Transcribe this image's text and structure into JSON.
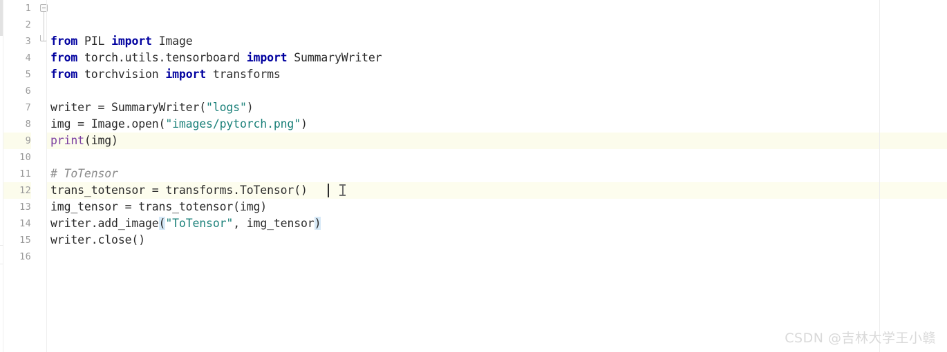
{
  "app": {
    "kind": "code-editor",
    "language": "Python",
    "theme": "light"
  },
  "colors": {
    "background": "#ffffff",
    "keyword": "#00009f",
    "string": "#1a8079",
    "builtin": "#7b3ea0",
    "comment": "#8c8c8c",
    "plain": "#2b2b2b",
    "line_number": "#9a9a9a",
    "current_line_bg": "#fdfdee",
    "bracket_match_bg": "#d6e9f7",
    "gutter_separator": "#eeeeee",
    "margin_guide": "#ededed",
    "watermark": "#d9d9d9"
  },
  "gutter": {
    "line_numbers": [
      "1",
      "2",
      "3",
      "4",
      "5",
      "6",
      "7",
      "8",
      "9",
      "10",
      "11",
      "12",
      "13",
      "14",
      "15",
      "16"
    ],
    "fold_markers": [
      {
        "line": 1,
        "type": "fold-collapse-box"
      },
      {
        "line": 3,
        "type": "fold-region-end"
      }
    ]
  },
  "editor": {
    "current_line": 12,
    "caret": {
      "line": 12,
      "column": 38
    },
    "bracket_match_lines": [
      12
    ],
    "margin_guide_column": 120,
    "lines": [
      {
        "n": 1,
        "text": "from PIL import Image"
      },
      {
        "n": 2,
        "text": "from torch.utils.tensorboard import SummaryWriter"
      },
      {
        "n": 3,
        "text": "from torchvision import transforms"
      },
      {
        "n": 4,
        "text": ""
      },
      {
        "n": 5,
        "text": "writer = SummaryWriter(\"logs\")"
      },
      {
        "n": 6,
        "text": "img = Image.open(\"images/pytorch.png\")"
      },
      {
        "n": 7,
        "text": "print(img)"
      },
      {
        "n": 8,
        "text": ""
      },
      {
        "n": 9,
        "text": "# ToTensor"
      },
      {
        "n": 10,
        "text": "trans_totensor = transforms.ToTensor()"
      },
      {
        "n": 11,
        "text": "img_tensor = trans_totensor(img)"
      },
      {
        "n": 12,
        "text": "writer.add_image(\"ToTensor\", img_tensor)"
      },
      {
        "n": 13,
        "text": "writer.close()"
      },
      {
        "n": 14,
        "text": ""
      },
      {
        "n": 15,
        "text": ""
      },
      {
        "n": 16,
        "text": ""
      }
    ]
  },
  "watermark": {
    "prefix": "CSDN",
    "handle": "@吉林大学王小赣",
    "full": "CSDN @吉林大学王小赣"
  }
}
